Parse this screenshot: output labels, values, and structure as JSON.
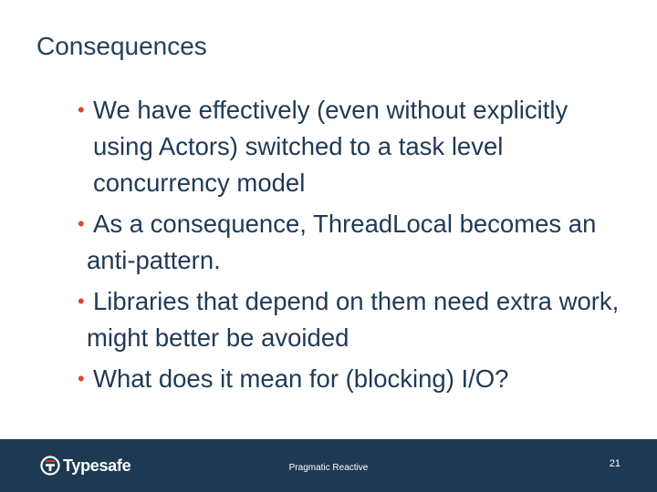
{
  "slide": {
    "title": "Consequences",
    "bullets": [
      {
        "text": "We have effectively (even without explicitly using Actors) switched to a task level concurrency model"
      },
      {
        "text": "As a consequence, ThreadLocal becomes an anti-pattern."
      },
      {
        "text": "Libraries that depend on them need extra work, might better be avoided"
      },
      {
        "text": "What does it mean for (blocking) I/O?"
      }
    ],
    "bullet_symbol": "•"
  },
  "footer": {
    "logo_text": "Typesafe",
    "center_text": "Pragmatic Reactive",
    "page_number": "21"
  },
  "colors": {
    "title": "#23405c",
    "body_text": "#1f3a56",
    "bullet": "#e1432f",
    "footer_bg": "#1d3a52"
  }
}
